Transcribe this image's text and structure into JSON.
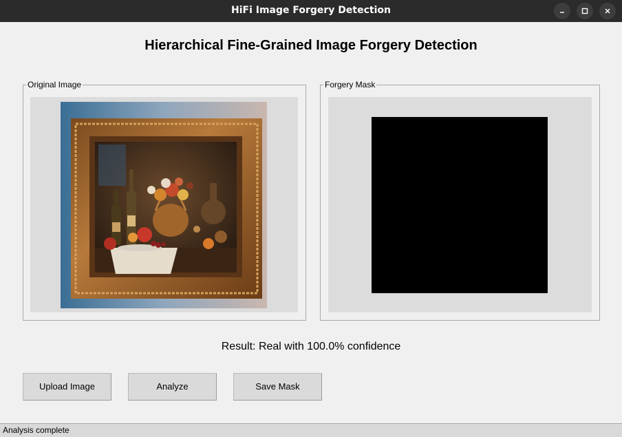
{
  "window": {
    "title": "HiFi Image Forgery Detection",
    "controls": [
      "minimize-icon",
      "maximize-icon",
      "close-icon"
    ]
  },
  "header": {
    "title": "Hierarchical Fine-Grained Image Forgery Detection"
  },
  "panels": {
    "original": {
      "label": "Original Image",
      "image": "still-life painting of fruit basket and wine bottles in ornate gold frame"
    },
    "mask": {
      "label": "Forgery Mask",
      "mask_color": "#000000"
    }
  },
  "result": {
    "text": "Result: Real with 100.0% confidence"
  },
  "buttons": {
    "upload": "Upload Image",
    "analyze": "Analyze",
    "save": "Save Mask"
  },
  "status": {
    "text": "Analysis complete"
  },
  "colors": {
    "titlebar": "#2b2b2b",
    "background": "#f0f0f0",
    "canvas": "#dcdcdc",
    "button": "#dadada"
  }
}
